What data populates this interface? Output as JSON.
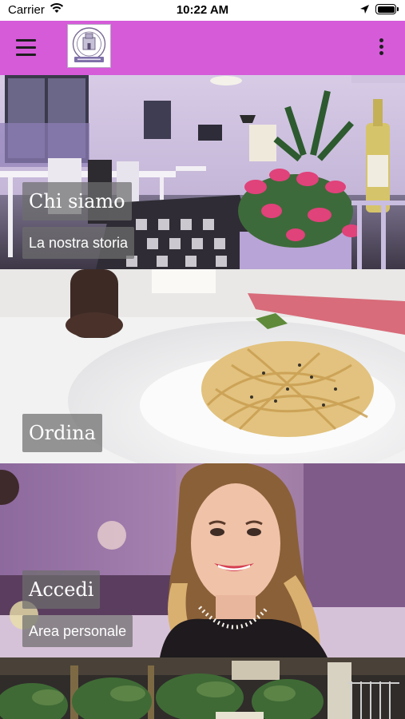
{
  "status_bar": {
    "carrier": "Carrier",
    "time": "10:22 AM",
    "wifi_icon": "wifi-icon",
    "location_icon": "location-arrow-icon",
    "battery_icon": "battery-icon"
  },
  "app_bar": {
    "background_color": "#d55bd9",
    "menu_icon": "hamburger-menu-icon",
    "logo_icon": "restaurant-logo-icon",
    "more_icon": "more-vertical-icon"
  },
  "tiles": [
    {
      "title": "Chi siamo",
      "subtitle": "La nostra storia"
    },
    {
      "title": "Ordina"
    },
    {
      "title": "Accedi",
      "subtitle": "Area personale"
    },
    {}
  ]
}
